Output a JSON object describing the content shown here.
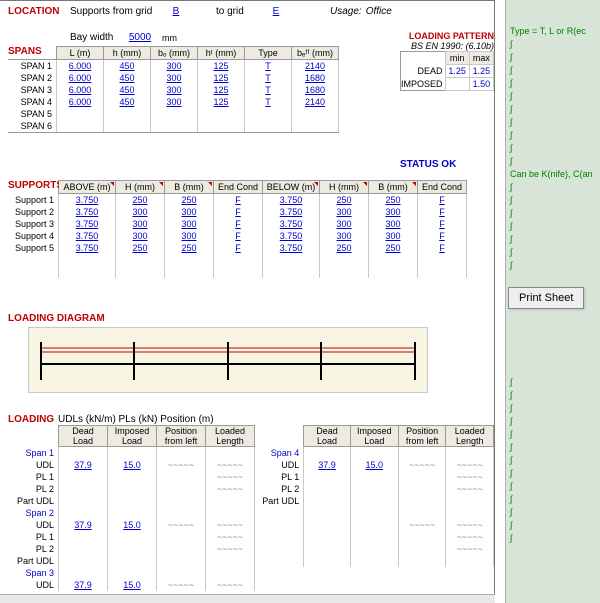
{
  "location": {
    "label": "LOCATION",
    "text": "Supports from grid",
    "grid_from": "B",
    "to": "to grid",
    "grid_to": "E"
  },
  "usage": {
    "label": "Usage:",
    "value": "Office"
  },
  "bay": {
    "label": "Bay width",
    "value": "5000",
    "unit": "mm"
  },
  "spans": {
    "title": "SPANS",
    "headers": [
      "L (m)",
      "h (mm)",
      "bₒ (mm)",
      "hᵗ (mm)",
      "Type",
      "bₑᶠᶠ (mm)"
    ],
    "rows": [
      {
        "name": "SPAN 1",
        "c": [
          "6.000",
          "450",
          "300",
          "125",
          "T",
          "2140"
        ]
      },
      {
        "name": "SPAN 2",
        "c": [
          "6.000",
          "450",
          "300",
          "125",
          "T",
          "1680"
        ]
      },
      {
        "name": "SPAN 3",
        "c": [
          "6.000",
          "450",
          "300",
          "125",
          "T",
          "1680"
        ]
      },
      {
        "name": "SPAN 4",
        "c": [
          "6.000",
          "450",
          "300",
          "125",
          "T",
          "2140"
        ]
      },
      {
        "name": "SPAN 5",
        "c": [
          "",
          "",
          "",
          "",
          "",
          ""
        ]
      },
      {
        "name": "SPAN 6",
        "c": [
          "",
          "",
          "",
          "",
          "",
          ""
        ]
      }
    ]
  },
  "loading_pattern": {
    "title": "LOADING PATTERN",
    "sub": "BS EN 1990: (6.10b)",
    "h": [
      "min",
      "max"
    ],
    "rows": [
      {
        "name": "DEAD",
        "c": [
          "1.25",
          "1.25"
        ]
      },
      {
        "name": "IMPOSED",
        "c": [
          "",
          "1.50"
        ]
      }
    ]
  },
  "status": "STATUS OK",
  "supports": {
    "title": "SUPPORTS",
    "headers": [
      "ABOVE (m)",
      "H (mm)",
      "B (mm)",
      "End Cond",
      "BELOW (m)",
      "H (mm)",
      "B (mm)",
      "End Cond"
    ],
    "rows": [
      {
        "name": "Support 1",
        "c": [
          "3.750",
          "250",
          "250",
          "F",
          "3.750",
          "250",
          "250",
          "F"
        ]
      },
      {
        "name": "Support 2",
        "c": [
          "3.750",
          "300",
          "300",
          "F",
          "3.750",
          "300",
          "300",
          "F"
        ]
      },
      {
        "name": "Support 3",
        "c": [
          "3.750",
          "300",
          "300",
          "F",
          "3.750",
          "300",
          "300",
          "F"
        ]
      },
      {
        "name": "Support 4",
        "c": [
          "3.750",
          "300",
          "300",
          "F",
          "3.750",
          "300",
          "300",
          "F"
        ]
      },
      {
        "name": "Support 5",
        "c": [
          "3.750",
          "250",
          "250",
          "F",
          "3.750",
          "250",
          "250",
          "F"
        ]
      }
    ]
  },
  "loading_diagram": "LOADING DIAGRAM",
  "loading": {
    "title": "LOADING",
    "units": "UDLs (kN/m)    PLs (kN)    Position (m)",
    "headers": [
      "Dead Load",
      "Imposed Load",
      "Position from left",
      "Loaded Length"
    ],
    "left_spans": [
      {
        "title": "Span 1",
        "rows": [
          {
            "name": "UDL",
            "c": [
              "37.9",
              "15.0",
              "~~~~~",
              "~~~~~"
            ]
          },
          {
            "name": "PL 1",
            "c": [
              "",
              "",
              "",
              "~~~~~"
            ]
          },
          {
            "name": "PL 2",
            "c": [
              "",
              "",
              "",
              "~~~~~"
            ]
          },
          {
            "name": "Part UDL",
            "c": [
              "",
              "",
              "",
              ""
            ]
          }
        ]
      },
      {
        "title": "Span 2",
        "rows": [
          {
            "name": "UDL",
            "c": [
              "37.9",
              "15.0",
              "~~~~~",
              "~~~~~"
            ]
          },
          {
            "name": "PL 1",
            "c": [
              "",
              "",
              "",
              "~~~~~"
            ]
          },
          {
            "name": "PL 2",
            "c": [
              "",
              "",
              "",
              "~~~~~"
            ]
          },
          {
            "name": "Part UDL",
            "c": [
              "",
              "",
              "",
              ""
            ]
          }
        ]
      },
      {
        "title": "Span 3",
        "rows": [
          {
            "name": "UDL",
            "c": [
              "37.9",
              "15.0",
              "~~~~~",
              "~~~~~"
            ]
          }
        ]
      }
    ],
    "right_spans": [
      {
        "title": "Span 4",
        "rows": [
          {
            "name": "UDL",
            "c": [
              "37.9",
              "15.0",
              "~~~~~",
              "~~~~~"
            ]
          },
          {
            "name": "PL 1",
            "c": [
              "",
              "",
              "",
              "~~~~~"
            ]
          },
          {
            "name": "PL 2",
            "c": [
              "",
              "",
              "",
              "~~~~~"
            ]
          },
          {
            "name": "Part UDL",
            "c": [
              "",
              "",
              "",
              ""
            ]
          }
        ]
      },
      {
        "title": "",
        "rows": [
          {
            "name": "",
            "c": [
              "",
              "",
              "~~~~~",
              "~~~~~"
            ]
          },
          {
            "name": "",
            "c": [
              "",
              "",
              "",
              "~~~~~"
            ]
          },
          {
            "name": "",
            "c": [
              "",
              "",
              "",
              "~~~~~"
            ]
          },
          {
            "name": "",
            "c": [
              "",
              "",
              "",
              ""
            ]
          }
        ]
      }
    ]
  },
  "side": {
    "hints": [
      "",
      "",
      "Type = T, L or R(ec",
      "∫",
      "∫",
      "∫",
      "∫",
      "∫",
      "∫",
      "∫",
      "∫",
      "∫",
      "∫",
      "Can be K(nife), C(an",
      "∫",
      "∫",
      "∫",
      "∫",
      "∫",
      "∫",
      "∫"
    ],
    "print": "Print Sheet",
    "hints2": [
      "∫",
      "∫",
      "∫",
      "∫",
      "∫",
      "∫",
      "∫",
      "∫",
      "∫",
      "∫",
      "∫",
      "∫",
      "∫"
    ]
  }
}
